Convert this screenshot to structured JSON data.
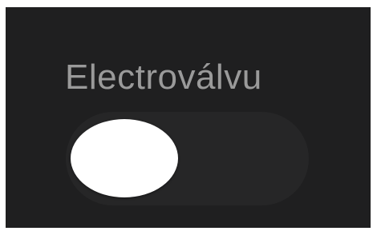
{
  "control": {
    "label": "Electroválvu",
    "state": "off"
  },
  "colors": {
    "panel_background": "#1f1f20",
    "label_text": "#9a9a9a",
    "switch_track": "#262627",
    "switch_knob": "#ffffff"
  }
}
